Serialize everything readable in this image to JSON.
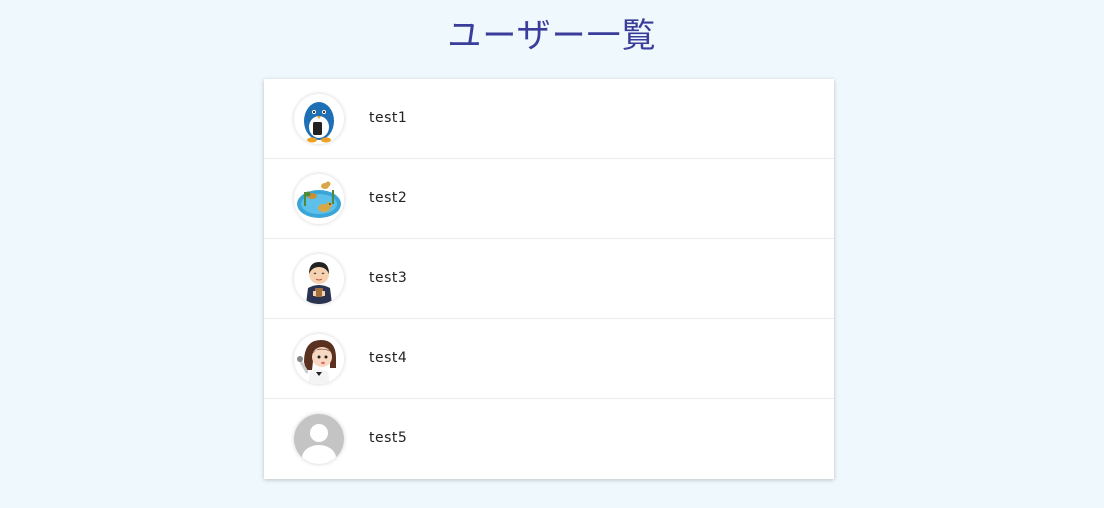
{
  "page": {
    "title": "ユーザー一覧"
  },
  "users": [
    {
      "name": "test1",
      "avatar_icon": "penguin-with-phone-icon"
    },
    {
      "name": "test2",
      "avatar_icon": "ducks-in-pond-icon"
    },
    {
      "name": "test3",
      "avatar_icon": "person-holding-cup-icon"
    },
    {
      "name": "test4",
      "avatar_icon": "girl-with-microphone-icon"
    },
    {
      "name": "test5",
      "avatar_icon": "default-user-icon"
    }
  ],
  "colors": {
    "background": "#eef8fd",
    "title": "#3a3d9a",
    "card": "#ffffff"
  }
}
